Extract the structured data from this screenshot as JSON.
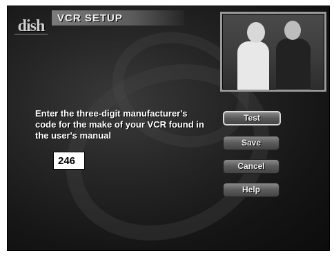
{
  "header": {
    "logo_text": "dish",
    "title": "VCR SETUP"
  },
  "main": {
    "prompt": "Enter the three-digit manufacturer's code for the make of your VCR found in the user's manual",
    "code_value": "246"
  },
  "buttons": {
    "test": "Test",
    "save": "Save",
    "cancel": "Cancel",
    "help": "Help"
  }
}
